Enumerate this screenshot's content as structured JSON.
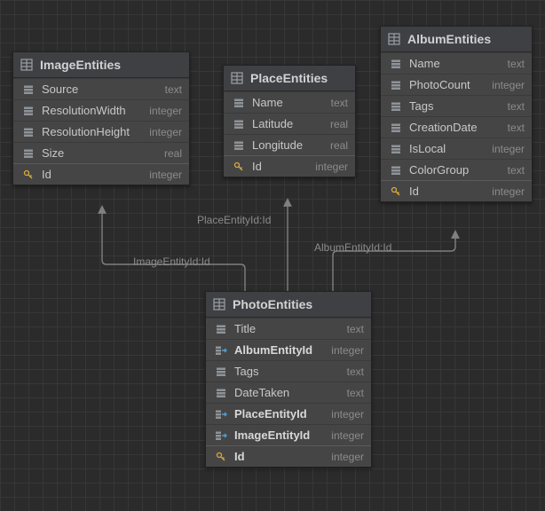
{
  "entities": {
    "image": {
      "title": "ImageEntities",
      "rows": [
        {
          "name": "Source",
          "type": "text"
        },
        {
          "name": "ResolutionWidth",
          "type": "integer"
        },
        {
          "name": "ResolutionHeight",
          "type": "integer"
        },
        {
          "name": "Size",
          "type": "real"
        }
      ],
      "pk": {
        "name": "Id",
        "type": "integer"
      }
    },
    "place": {
      "title": "PlaceEntities",
      "rows": [
        {
          "name": "Name",
          "type": "text"
        },
        {
          "name": "Latitude",
          "type": "real"
        },
        {
          "name": "Longitude",
          "type": "real"
        }
      ],
      "pk": {
        "name": "Id",
        "type": "integer"
      }
    },
    "album": {
      "title": "AlbumEntities",
      "rows": [
        {
          "name": "Name",
          "type": "text"
        },
        {
          "name": "PhotoCount",
          "type": "integer"
        },
        {
          "name": "Tags",
          "type": "text"
        },
        {
          "name": "CreationDate",
          "type": "text"
        },
        {
          "name": "IsLocal",
          "type": "integer"
        },
        {
          "name": "ColorGroup",
          "type": "text"
        }
      ],
      "pk": {
        "name": "Id",
        "type": "integer"
      }
    },
    "photo": {
      "title": "PhotoEntities",
      "rows": [
        {
          "name": "Title",
          "type": "text",
          "fk": false
        },
        {
          "name": "AlbumEntityId",
          "type": "integer",
          "fk": true
        },
        {
          "name": "Tags",
          "type": "text",
          "fk": false
        },
        {
          "name": "DateTaken",
          "type": "text",
          "fk": false
        },
        {
          "name": "PlaceEntityId",
          "type": "integer",
          "fk": true
        },
        {
          "name": "ImageEntityId",
          "type": "integer",
          "fk": true
        }
      ],
      "pk": {
        "name": "Id",
        "type": "integer"
      }
    }
  },
  "labels": {
    "image_rel": "ImageEntityId:Id",
    "place_rel": "PlaceEntityId:Id",
    "album_rel": "AlbumEntityId:Id"
  }
}
